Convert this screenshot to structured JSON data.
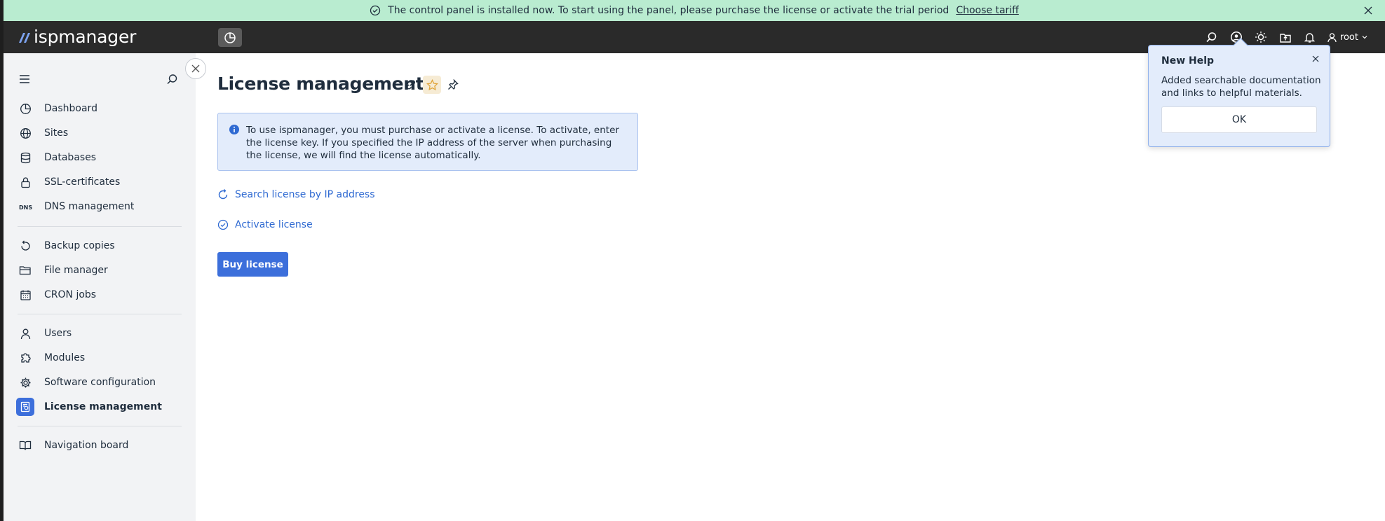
{
  "banner": {
    "message": "The control panel is installed now. To start using the panel, please purchase the license or activate the trial period",
    "link": "Choose tariff"
  },
  "header": {
    "logo": "ispmanager",
    "user": "root"
  },
  "sidebar": {
    "items": [
      {
        "label": "Dashboard",
        "icon": "dashboard-icon"
      },
      {
        "label": "Sites",
        "icon": "globe-icon"
      },
      {
        "label": "Databases",
        "icon": "database-icon"
      },
      {
        "label": "SSL-certificates",
        "icon": "lock-icon"
      },
      {
        "label": "DNS management",
        "icon": "dns-icon"
      },
      {
        "label": "Backup copies",
        "icon": "backup-icon"
      },
      {
        "label": "File manager",
        "icon": "folder-icon"
      },
      {
        "label": "CRON jobs",
        "icon": "calendar-icon"
      },
      {
        "label": "Users",
        "icon": "user-icon"
      },
      {
        "label": "Modules",
        "icon": "puzzle-icon"
      },
      {
        "label": "Software configuration",
        "icon": "gear-icon"
      },
      {
        "label": "License management",
        "icon": "license-icon",
        "active": true
      },
      {
        "label": "Navigation board",
        "icon": "book-icon"
      }
    ]
  },
  "main": {
    "title": "License management",
    "info": "To use ispmanager, you must purchase or activate a license. To activate, enter the license key. If you specified the IP address of the server when purchasing the license, we will find the license automatically.",
    "search_link": "Search license by IP address",
    "activate_link": "Activate license",
    "buy_button": "Buy license"
  },
  "popup": {
    "title": "New Help",
    "text": "Added searchable documentation and links to helpful materials.",
    "ok": "OK"
  },
  "colors": {
    "banner_bg": "#b9ecd0",
    "header_bg": "#2a2a2a",
    "accent": "#3c6fdb",
    "link": "#2f6ad2"
  }
}
